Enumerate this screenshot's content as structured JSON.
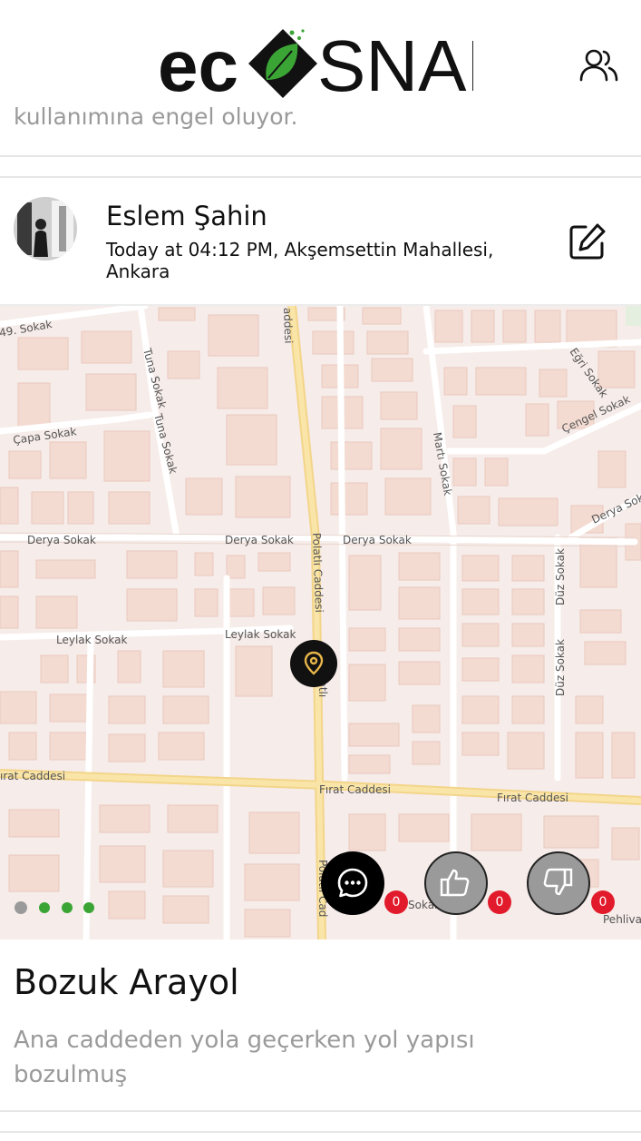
{
  "header": {
    "logo_left": "ec",
    "logo_right": "SNAP"
  },
  "previous_post": {
    "text": "kullanımına engel oluyor."
  },
  "post": {
    "author": "Eslem Şahin",
    "meta": "Today at 04:12 PM, Akşemsettin Mahallesi, Ankara",
    "title": "Bozuk Arayol",
    "description": "Ana caddeden yola geçerken yol yapısı bozulmuş",
    "actions": {
      "comments_count": "0",
      "likes_count": "0",
      "dislikes_count": "0"
    },
    "carousel": {
      "total": 4,
      "active_index": 0
    }
  },
  "map": {
    "streets": {
      "s49": "49. Sokak",
      "tuna1": "Tuna Sokak",
      "tuna2": "Tuna Sokak",
      "capa": "Çapa Sokak",
      "egri": "Eğri Sokak",
      "cengel": "Çengel Sokak",
      "marti": "Martı Sokak",
      "derya1": "Derya Sokak",
      "derya2": "Derya Sokak",
      "derya3": "Derya Sokak",
      "derya4": "Derya Sokak",
      "polatli1": "Polatlı Caddesi",
      "polatli_top": "addesi",
      "polatli_mid": "Polatlı",
      "polatli_bot": "Polatlı Cad",
      "leylak1": "Leylak Sokak",
      "leylak2": "Leylak Sokak",
      "duz1": "Düz Sokak",
      "duz2": "Düz Sokak",
      "firat1": "ırat Caddesi",
      "firat2": "Fırat Caddesi",
      "firat3": "Fırat Caddesi",
      "pehliva": "Pehliva",
      "sokak": "Sokak"
    }
  },
  "colors": {
    "accent_green": "#3aa535",
    "badge_red": "#e21b2c",
    "pin_gold": "#e8b64a",
    "map_bg": "#f6ece9",
    "main_road": "#f9dd8c"
  }
}
